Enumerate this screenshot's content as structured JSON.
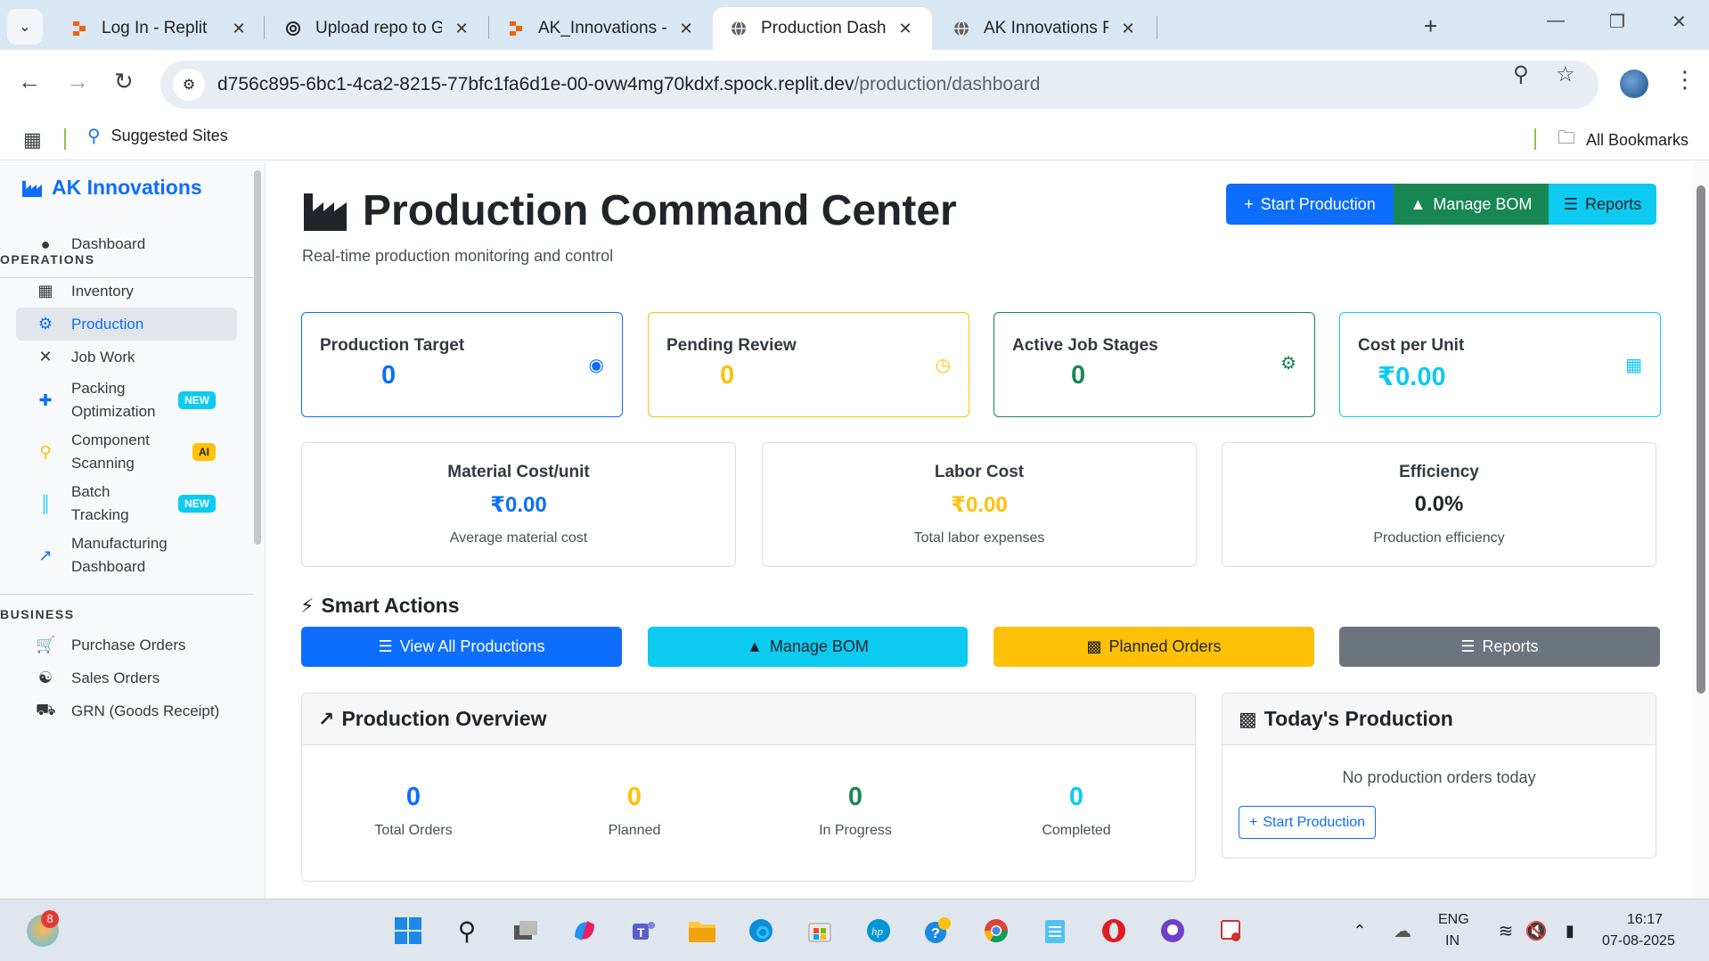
{
  "browser": {
    "tabs": [
      {
        "label": "Log In - Replit",
        "icon": "replit-icon",
        "active": false
      },
      {
        "label": "Upload repo to GitHub",
        "icon": "openai-icon",
        "active": false
      },
      {
        "label": "AK_Innovations - Replit",
        "icon": "replit-icon",
        "active": false
      },
      {
        "label": "Production Dashboard - ",
        "icon": "globe-icon",
        "active": true
      },
      {
        "label": "AK Innovations Factory M",
        "icon": "globe-icon",
        "active": false
      }
    ],
    "url_host": "d756c895-6bc1-4ca2-8215-77bfc1fa6d1e-00-ovw4mg70kdxf.spock.replit.dev",
    "url_path": "/production/dashboard",
    "bookmarks": {
      "suggested": "Suggested Sites",
      "all": "All Bookmarks"
    }
  },
  "sidebar": {
    "brand": "AK Innovations",
    "dashboard": "Dashboard",
    "sections": [
      {
        "heading": "OPERATIONS",
        "items": [
          {
            "label": "Inventory",
            "icon": "boxes-icon",
            "badge": ""
          },
          {
            "label": "Production",
            "icon": "cogs-icon",
            "badge": "",
            "active": true
          },
          {
            "label": "Job Work",
            "icon": "tools-icon",
            "badge": ""
          },
          {
            "label": "Packing\nOptimization",
            "icon": "puzzle-icon",
            "badge": "NEW"
          },
          {
            "label": "Component\nScanning",
            "icon": "search-icon",
            "badge": "AI"
          },
          {
            "label": "Batch\nTracking",
            "icon": "barcode-icon",
            "badge": "NEW"
          },
          {
            "label": "Manufacturing\nDashboard",
            "icon": "chart-line-icon",
            "badge": ""
          }
        ]
      },
      {
        "heading": "BUSINESS",
        "items": [
          {
            "label": "Purchase Orders",
            "icon": "cart-icon"
          },
          {
            "label": "Sales Orders",
            "icon": "handshake-icon"
          },
          {
            "label": "GRN (Goods Receipt)",
            "icon": "truck-icon"
          }
        ]
      }
    ]
  },
  "header": {
    "title": "Production Command Center",
    "subtitle": "Real-time production monitoring and control",
    "buttons": {
      "start": "Start Production",
      "bom": "Manage BOM",
      "reports": "Reports"
    }
  },
  "stats": [
    {
      "label": "Production Target",
      "value": "0",
      "color": "#0d6efd",
      "icon": "bullseye-icon"
    },
    {
      "label": "Pending Review",
      "value": "0",
      "color": "#ffc107",
      "icon": "clock-icon"
    },
    {
      "label": "Active Job Stages",
      "value": "0",
      "color": "#198754",
      "icon": "cogs-icon"
    },
    {
      "label": "Cost per Unit",
      "value": "₹0.00",
      "color": "#0dcaf0",
      "icon": "calculator-icon"
    }
  ],
  "metrics": [
    {
      "title": "Material Cost/unit",
      "value": "₹0.00",
      "sub": "Average material cost",
      "color": "#0d6efd"
    },
    {
      "title": "Labor Cost",
      "value": "₹0.00",
      "sub": "Total labor expenses",
      "color": "#ffc107"
    },
    {
      "title": "Efficiency",
      "value": "0.0%",
      "sub": "Production efficiency",
      "color": "#212529"
    }
  ],
  "smart_actions": {
    "heading": "Smart Actions",
    "buttons": [
      "View All Productions",
      "Manage BOM",
      "Planned Orders",
      "Reports"
    ]
  },
  "overview": {
    "title": "Production Overview",
    "stats": [
      {
        "value": "0",
        "label": "Total Orders",
        "color": "#0d6efd"
      },
      {
        "value": "0",
        "label": "Planned",
        "color": "#ffc107"
      },
      {
        "value": "0",
        "label": "In Progress",
        "color": "#198754"
      },
      {
        "value": "0",
        "label": "Completed",
        "color": "#0dcaf0"
      }
    ]
  },
  "today": {
    "title": "Today's Production",
    "empty": "No production orders today",
    "button": "Start Production"
  },
  "taskbar": {
    "notification_count": "8",
    "lang": "ENG",
    "region": "IN",
    "time": "16:17",
    "date": "07-08-2025"
  }
}
